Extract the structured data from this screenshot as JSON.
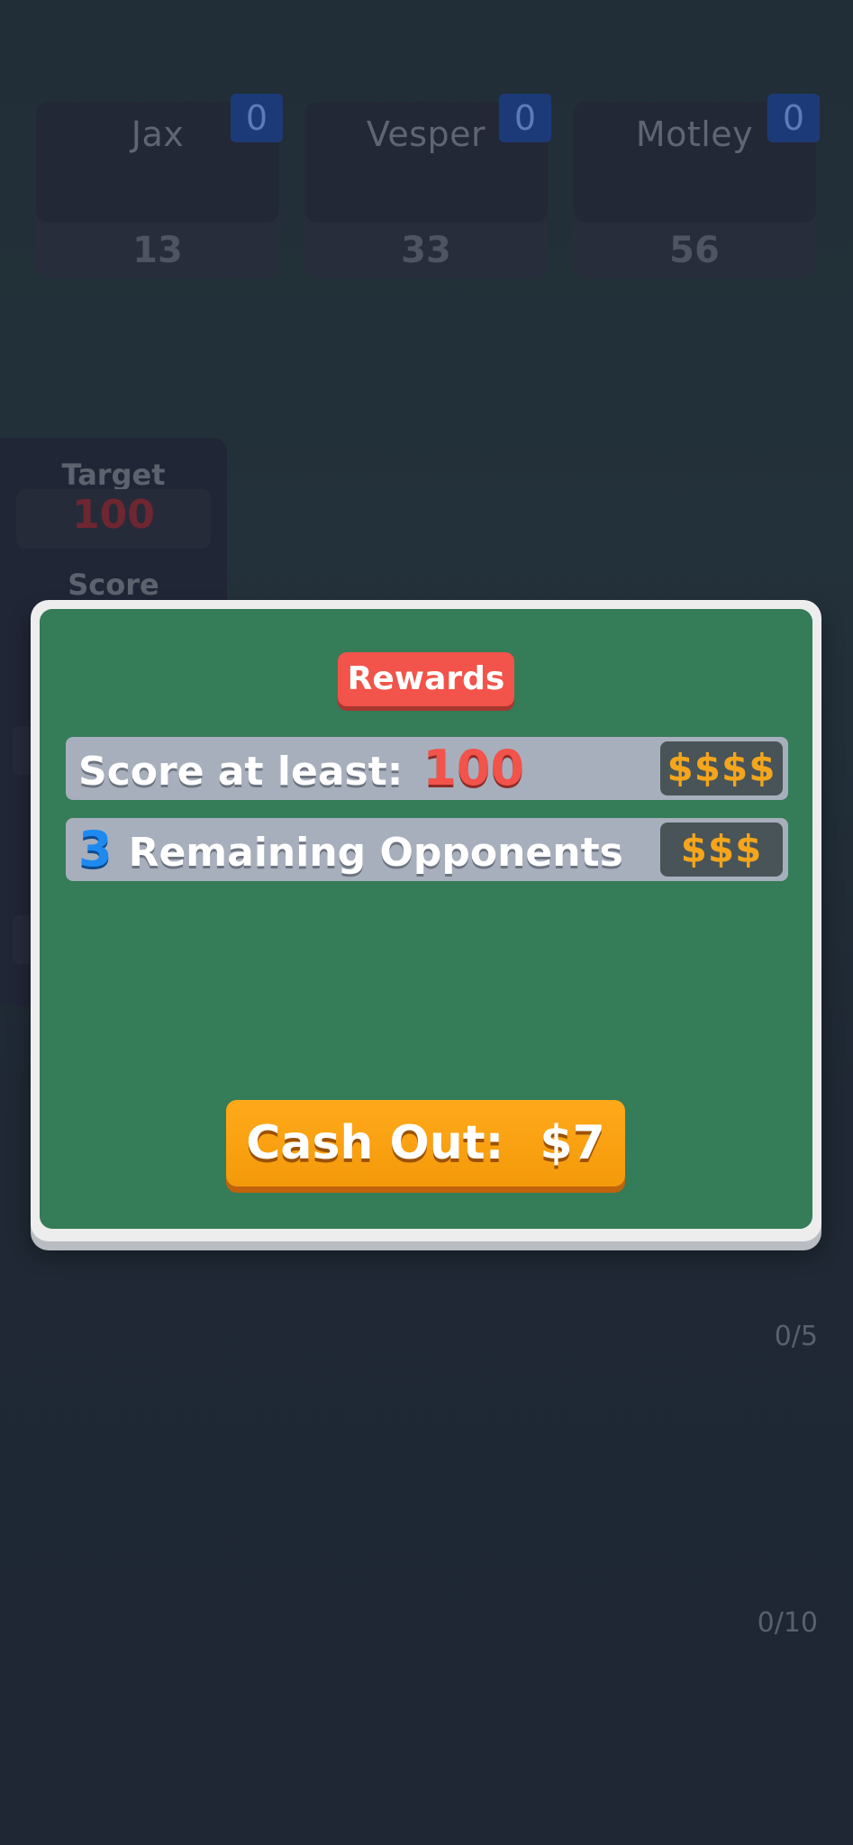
{
  "opponents": [
    {
      "name": "Jax",
      "score": "13",
      "badge": "0"
    },
    {
      "name": "Vesper",
      "score": "33",
      "badge": "0"
    },
    {
      "name": "Motley",
      "score": "56",
      "badge": "0"
    }
  ],
  "panel": {
    "target_label": "Target",
    "target_value": "100",
    "score_label": "Score"
  },
  "counters": {
    "upper": "0/5",
    "lower": "0/10"
  },
  "modal": {
    "title": "Rewards",
    "rows": [
      {
        "text": "Score at least:",
        "highlight": "100",
        "cost": "$$$$"
      },
      {
        "text": "Remaining Opponents",
        "highlight": "3",
        "cost": "$$$"
      }
    ],
    "cashout_label": "Cash Out:",
    "cashout_amount": "$7"
  },
  "colors": {
    "background": "#1f2733",
    "modal_felt": "#357c58",
    "reward_pill": "#f2534a",
    "cashout": "#ffa91a",
    "cost_text": "#f4a51c",
    "highlight_red": "#f2534a",
    "highlight_blue": "#1e8af0"
  }
}
